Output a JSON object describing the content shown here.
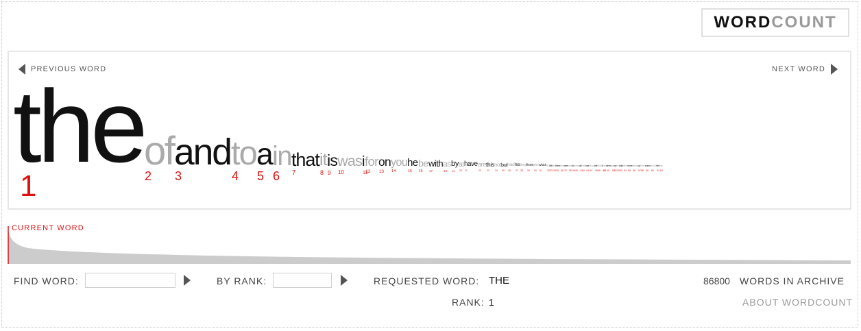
{
  "logo": {
    "word": "WORD",
    "count": "COUNT"
  },
  "nav": {
    "previous": "PREVIOUS WORD",
    "next": "NEXT WORD"
  },
  "colors": {
    "black": "#111111",
    "gray": "#aaaaaa",
    "rank": "#e01010",
    "curve": "#cccccc"
  },
  "words": [
    {
      "text": "the",
      "rank": "1",
      "shade": "black"
    },
    {
      "text": "of",
      "rank": "2",
      "shade": "gray"
    },
    {
      "text": "and",
      "rank": "3",
      "shade": "black"
    },
    {
      "text": "to",
      "rank": "4",
      "shade": "gray"
    },
    {
      "text": "a",
      "rank": "5",
      "shade": "black"
    },
    {
      "text": "in",
      "rank": "6",
      "shade": "gray"
    },
    {
      "text": "that",
      "rank": "7",
      "shade": "black"
    },
    {
      "text": "it",
      "rank": "8",
      "shade": "gray"
    },
    {
      "text": "is",
      "rank": "9",
      "shade": "black"
    },
    {
      "text": "was",
      "rank": "10",
      "shade": "gray"
    },
    {
      "text": "i",
      "rank": "11",
      "shade": "black"
    },
    {
      "text": "for",
      "rank": "12",
      "shade": "gray"
    },
    {
      "text": "on",
      "rank": "13",
      "shade": "black"
    },
    {
      "text": "you",
      "rank": "14",
      "shade": "gray"
    },
    {
      "text": "he",
      "rank": "15",
      "shade": "black"
    },
    {
      "text": "be",
      "rank": "16",
      "shade": "gray"
    },
    {
      "text": "with",
      "rank": "17",
      "shade": "black"
    },
    {
      "text": "as",
      "rank": "18",
      "shade": "gray"
    },
    {
      "text": "by",
      "rank": "19",
      "shade": "black"
    },
    {
      "text": "at",
      "rank": "20",
      "shade": "gray"
    },
    {
      "text": "have",
      "rank": "21",
      "shade": "black"
    },
    {
      "text": "are",
      "rank": "22",
      "shade": "gray"
    },
    {
      "text": "this",
      "rank": "23",
      "shade": "black"
    },
    {
      "text": "not",
      "rank": "24",
      "shade": "gray"
    },
    {
      "text": "but",
      "rank": "25",
      "shade": "black"
    },
    {
      "text": "had",
      "rank": "26",
      "shade": "gray"
    },
    {
      "text": "his",
      "rank": "27",
      "shade": "black"
    },
    {
      "text": "they",
      "rank": "28",
      "shade": "gray"
    },
    {
      "text": "from",
      "rank": "29",
      "shade": "black"
    },
    {
      "text": "she",
      "rank": "30",
      "shade": "gray"
    },
    {
      "text": "which",
      "rank": "31",
      "shade": "black"
    },
    {
      "text": "or",
      "rank": "32",
      "shade": "gray"
    },
    {
      "text": "we",
      "rank": "33",
      "shade": "black"
    },
    {
      "text": "an",
      "rank": "34",
      "shade": "gray"
    },
    {
      "text": "there",
      "rank": "35",
      "shade": "black"
    },
    {
      "text": "her",
      "rank": "36",
      "shade": "gray"
    },
    {
      "text": "were",
      "rank": "37",
      "shade": "black"
    },
    {
      "text": "one",
      "rank": "38",
      "shade": "gray"
    },
    {
      "text": "do",
      "rank": "39",
      "shade": "black"
    },
    {
      "text": "been",
      "rank": "40",
      "shade": "gray"
    },
    {
      "text": "all",
      "rank": "41",
      "shade": "black"
    },
    {
      "text": "their",
      "rank": "42",
      "shade": "gray"
    },
    {
      "text": "has",
      "rank": "43",
      "shade": "black"
    },
    {
      "text": "would",
      "rank": "44",
      "shade": "gray"
    },
    {
      "text": "will",
      "rank": "45",
      "shade": "black"
    },
    {
      "text": "what",
      "rank": "46",
      "shade": "gray"
    },
    {
      "text": "if",
      "rank": "47",
      "shade": "black"
    },
    {
      "text": "can",
      "rank": "48",
      "shade": "gray"
    },
    {
      "text": "when",
      "rank": "49",
      "shade": "black"
    },
    {
      "text": "so",
      "rank": "50",
      "shade": "gray"
    },
    {
      "text": "my",
      "rank": "51",
      "shade": "black"
    },
    {
      "text": "no",
      "rank": "52",
      "shade": "gray"
    },
    {
      "text": "said",
      "rank": "53",
      "shade": "black"
    },
    {
      "text": "who",
      "rank": "54",
      "shade": "gray"
    },
    {
      "text": "more",
      "rank": "55",
      "shade": "black"
    },
    {
      "text": "about",
      "rank": "56",
      "shade": "gray"
    },
    {
      "text": "up",
      "rank": "57",
      "shade": "black"
    },
    {
      "text": "them",
      "rank": "58",
      "shade": "gray"
    },
    {
      "text": "some",
      "rank": "59",
      "shade": "black"
    },
    {
      "text": "could",
      "rank": "60",
      "shade": "gray"
    },
    {
      "text": "him",
      "rank": "61",
      "shade": "black"
    },
    {
      "text": "into",
      "rank": "62",
      "shade": "gray"
    }
  ],
  "current_word_label": "CURRENT WORD",
  "controls": {
    "find_word_label": "FIND WORD:",
    "find_word_value": "",
    "by_rank_label": "BY RANK:",
    "by_rank_value": "",
    "requested_label": "REQUESTED WORD:",
    "requested_value": "THE",
    "rank_label": "RANK:",
    "rank_value": "1",
    "archive_count": "86800",
    "archive_label": "WORDS IN ARCHIVE",
    "about": "ABOUT WORDCOUNT"
  }
}
